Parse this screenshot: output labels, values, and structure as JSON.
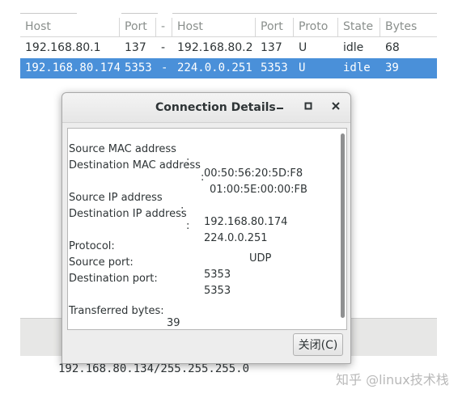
{
  "table": {
    "headers": [
      "Host",
      "Port",
      "-",
      "Host",
      "Port",
      "Proto",
      "State",
      "Bytes"
    ],
    "rows": [
      [
        "192.168.80.1",
        "137",
        "-",
        "192.168.80.2",
        "137",
        "U",
        "idle",
        "68"
      ],
      [
        "192.168.80.174",
        "5353",
        "-",
        "224.0.0.251",
        "5353",
        "U",
        "idle",
        "39"
      ]
    ]
  },
  "background": {
    "netmask": "192.168.80.134/255.255.255.0",
    "watermark": "知乎 @linux技术栈"
  },
  "dialog": {
    "title": "Connection Details",
    "minimize_icon": "minimize-icon",
    "maximize_icon": "maximize-icon",
    "close_icon": "close-icon",
    "details": {
      "src_mac_label": "Source MAC address",
      "src_mac_value": "00:50:56:20:5D:F8",
      "dst_mac_label": "Destination MAC address",
      "dst_mac_value": "01:00:5E:00:00:FB",
      "src_ip_label": "Source IP address",
      "src_ip_value": "192.168.80.174",
      "dst_ip_label": "Destination IP address",
      "dst_ip_value": "224.0.0.251",
      "protocol_label": "Protocol:",
      "protocol_value": "UDP",
      "src_port_label": "Source port:",
      "src_port_value": "5353",
      "dst_port_label": "Destination port:",
      "dst_port_value": "5353",
      "bytes_label": "Transferred bytes:",
      "bytes_value": "39"
    },
    "close_button": "关闭(C)"
  },
  "colors": {
    "selection": "#4a90d9",
    "dialog_bg": "#ededed"
  }
}
